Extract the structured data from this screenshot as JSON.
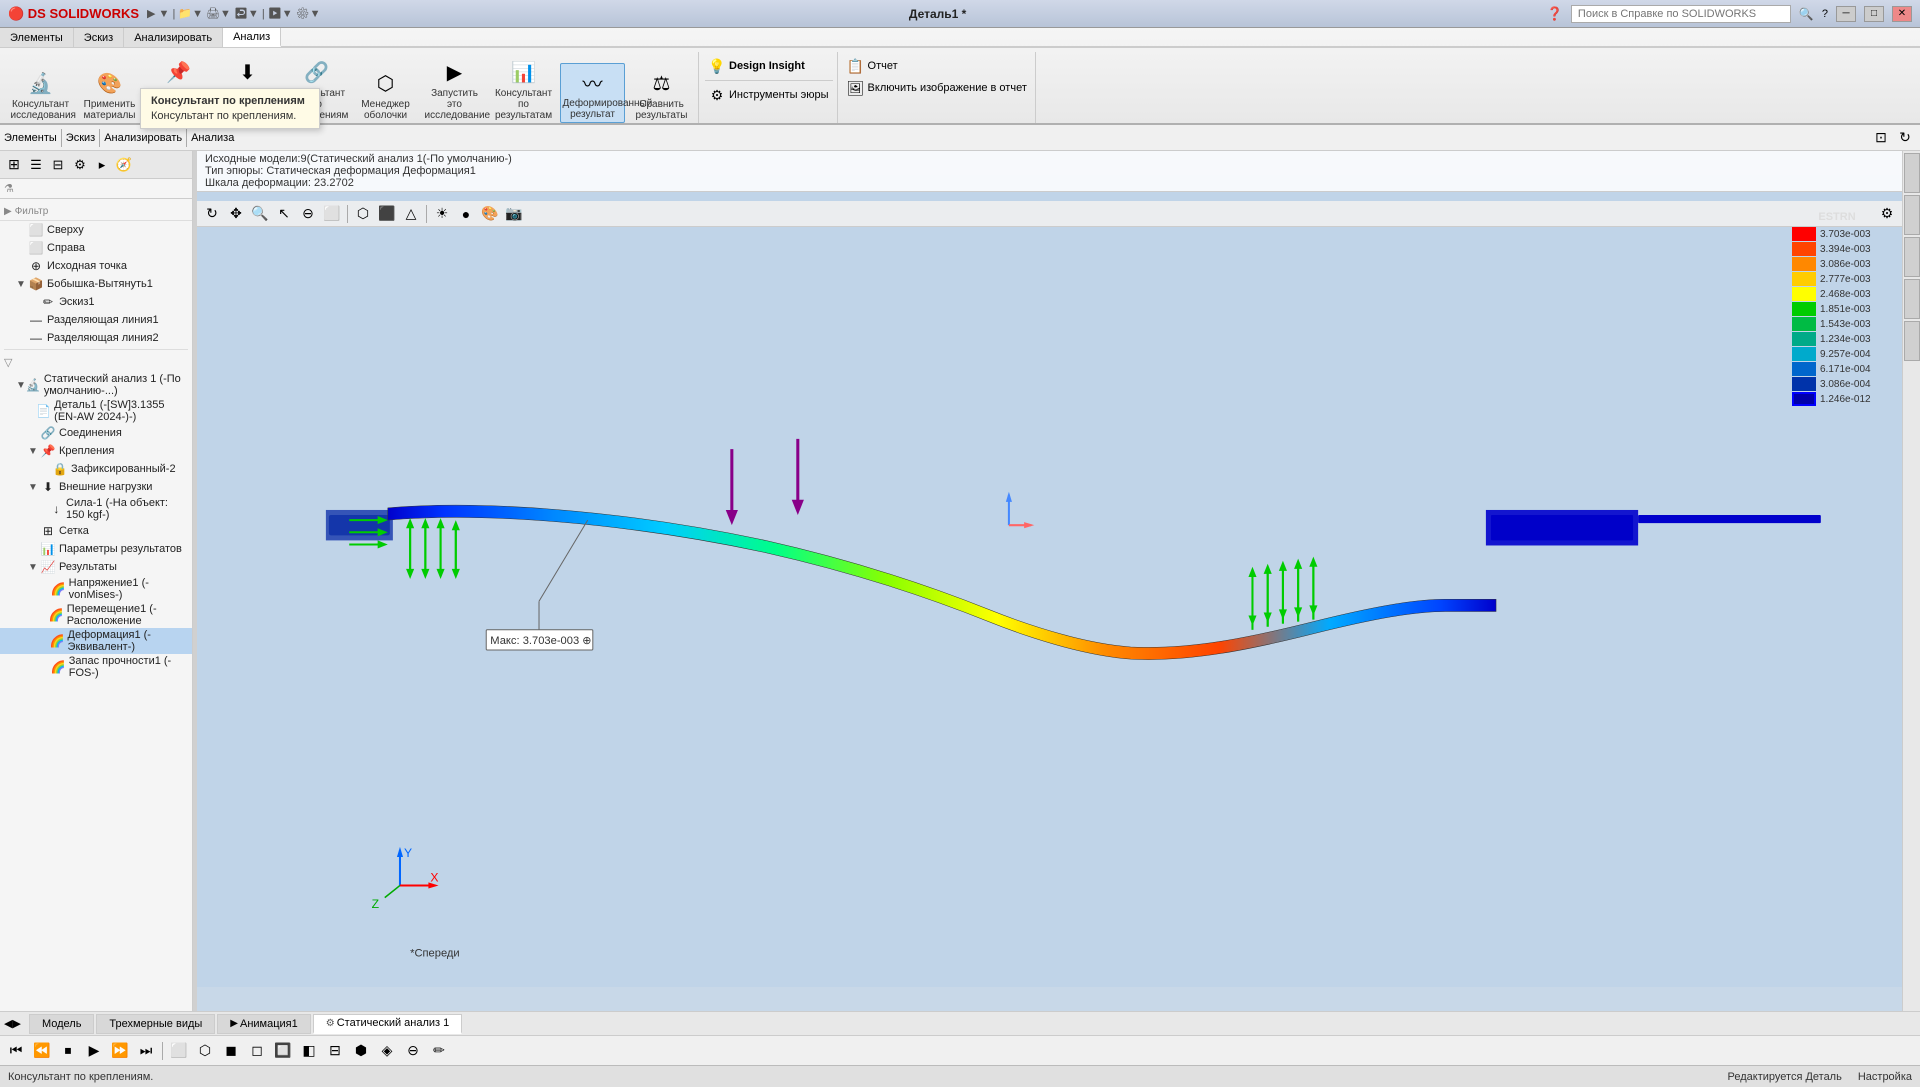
{
  "titlebar": {
    "logo": "DS SOLIDWORKS",
    "title": "Деталь1 *",
    "search_placeholder": "Поиск в Справке по SOLIDWORKS",
    "min_btn": "─",
    "max_btn": "□",
    "close_btn": "✕"
  },
  "ribbon": {
    "tabs": [
      "Элементы",
      "Эскиз",
      "Анализировать",
      "Анализ"
    ],
    "active_tab": "Анализ",
    "groups": {
      "consultant_research": "Консультант исследования",
      "apply_materials": "Применить материал",
      "consultant_fixations": "Консультант по креплениям",
      "consultant_loads": "Консультант по внешним нагрузкам",
      "consultant_connections": "Консультант по соединениям",
      "manager_shell": "Менеджер оболочки",
      "launch_research": "Запустить это исследование",
      "consultant_results": "Консультант по результатам",
      "deformed_result": "Деформированный результат",
      "compare_results": "Сравнить результаты",
      "design_insight": "Design Insight",
      "simulation_tools": "Инструменты эюры",
      "report": "Отчет",
      "include_image": "Включить изображение в отчет"
    }
  },
  "tooltip": {
    "title": "Консультант по креплениям",
    "body": "Консультант по креплениям."
  },
  "infobar": {
    "study": "Статический анализ 1(-По умолчанию-)(Статический анализ 1(-По умолчанию-))",
    "type": "Тип эпюры: Статическая деформация Деформация1",
    "scale": "Шкала деформации: 23.2702"
  },
  "tree": {
    "items": [
      {
        "id": "sverhu",
        "label": "Сверху",
        "indent": 1,
        "expand": false,
        "icon": "🔲"
      },
      {
        "id": "sprava",
        "label": "Справа",
        "indent": 1,
        "expand": false,
        "icon": "🔲"
      },
      {
        "id": "source",
        "label": "Исходная точка",
        "indent": 1,
        "expand": false,
        "icon": "⊕"
      },
      {
        "id": "bobushka",
        "label": "Бобышка-Вытянуть1",
        "indent": 1,
        "expand": true,
        "icon": "📦"
      },
      {
        "id": "eskiz1",
        "label": "Эскиз1",
        "indent": 2,
        "expand": false,
        "icon": "✏"
      },
      {
        "id": "razd1",
        "label": "Разделяющая линия1",
        "indent": 1,
        "expand": false,
        "icon": "—"
      },
      {
        "id": "razd2",
        "label": "Разделяющая линия2",
        "indent": 1,
        "expand": false,
        "icon": "—"
      },
      {
        "id": "sep1",
        "type": "sep"
      },
      {
        "id": "static1",
        "label": "Статический анализ 1 (-По умолчанию-...)",
        "indent": 1,
        "expand": true,
        "icon": "🔬"
      },
      {
        "id": "detail1",
        "label": "Деталь1 (-[SW]3.1355 (EN-AW 2024-)-)",
        "indent": 2,
        "expand": false,
        "icon": "📄"
      },
      {
        "id": "soed",
        "label": "Соединения",
        "indent": 2,
        "expand": false,
        "icon": "🔗"
      },
      {
        "id": "krep",
        "label": "Крепления",
        "indent": 2,
        "expand": true,
        "icon": "📌"
      },
      {
        "id": "fixed2",
        "label": "Зафиксированный-2",
        "indent": 3,
        "expand": false,
        "icon": "🔒"
      },
      {
        "id": "vneshn",
        "label": "Внешние нагрузки",
        "indent": 2,
        "expand": true,
        "icon": "⬇"
      },
      {
        "id": "sila1",
        "label": "Сила-1 (-На объект: 150 kgf-)",
        "indent": 3,
        "expand": false,
        "icon": "↓"
      },
      {
        "id": "setka",
        "label": "Сетка",
        "indent": 2,
        "expand": false,
        "icon": "⊞"
      },
      {
        "id": "params",
        "label": "Параметры результатов",
        "indent": 2,
        "expand": false,
        "icon": "📊"
      },
      {
        "id": "results",
        "label": "Результаты",
        "indent": 2,
        "expand": true,
        "icon": "📈"
      },
      {
        "id": "napr1",
        "label": "Напряжение1 (-vonMises-)",
        "indent": 3,
        "expand": false,
        "icon": "🌈"
      },
      {
        "id": "perem1",
        "label": "Перемещение1 (-Расположение",
        "indent": 3,
        "expand": false,
        "icon": "🌈"
      },
      {
        "id": "deform1",
        "label": "Деформация1 (-Эквивалент-)",
        "indent": 3,
        "expand": false,
        "icon": "🌈",
        "selected": true
      },
      {
        "id": "zapas1",
        "label": "Запас прочности1 (-FOS-)",
        "indent": 3,
        "expand": false,
        "icon": "🌈"
      }
    ]
  },
  "legend": {
    "title": "ESTRN",
    "values": [
      {
        "value": "3.703e-003",
        "color": "#FF0000",
        "selected": false
      },
      {
        "value": "3.394e-003",
        "color": "#FF4400",
        "selected": false
      },
      {
        "value": "3.086e-003",
        "color": "#FF8800",
        "selected": false
      },
      {
        "value": "2.777e-003",
        "color": "#FFCC00",
        "selected": false
      },
      {
        "value": "2.468e-003",
        "color": "#FFFF00",
        "selected": false
      },
      {
        "value": "1.851e-003",
        "color": "#00CC00",
        "selected": false
      },
      {
        "value": "1.543e-003",
        "color": "#00BB44",
        "selected": false
      },
      {
        "value": "1.234e-003",
        "color": "#00AA88",
        "selected": false
      },
      {
        "value": "9.257e-004",
        "color": "#00AACC",
        "selected": false
      },
      {
        "value": "6.171e-004",
        "color": "#0066CC",
        "selected": false
      },
      {
        "value": "3.086e-004",
        "color": "#0033AA",
        "selected": false
      },
      {
        "value": "1.246e-012",
        "color": "#0000AA",
        "selected": true
      }
    ]
  },
  "callout": {
    "label": "Макс:",
    "value": "3.703e-003",
    "symbol": "⊕"
  },
  "bottom_tabs": [
    {
      "id": "model",
      "label": "Модель",
      "active": false,
      "icon": ""
    },
    {
      "id": "3d_views",
      "label": "Трехмерные виды",
      "active": false,
      "icon": ""
    },
    {
      "id": "animation1",
      "label": "Анимация1",
      "active": false,
      "icon": "▶"
    },
    {
      "id": "static_analysis",
      "label": "Статический анализ 1",
      "active": true,
      "icon": "⚙"
    }
  ],
  "status_left": "Консультант по креплениям.",
  "status_right1": "Редактируется Деталь",
  "status_right2": "Настройка",
  "viewport_toolbar_icons": [
    "🔍",
    "✂",
    "↩",
    "⬜",
    "◎",
    "⬡",
    "⬛",
    "△",
    "✕",
    "◻",
    "⬤",
    "○"
  ],
  "current_view": "*Спереди"
}
